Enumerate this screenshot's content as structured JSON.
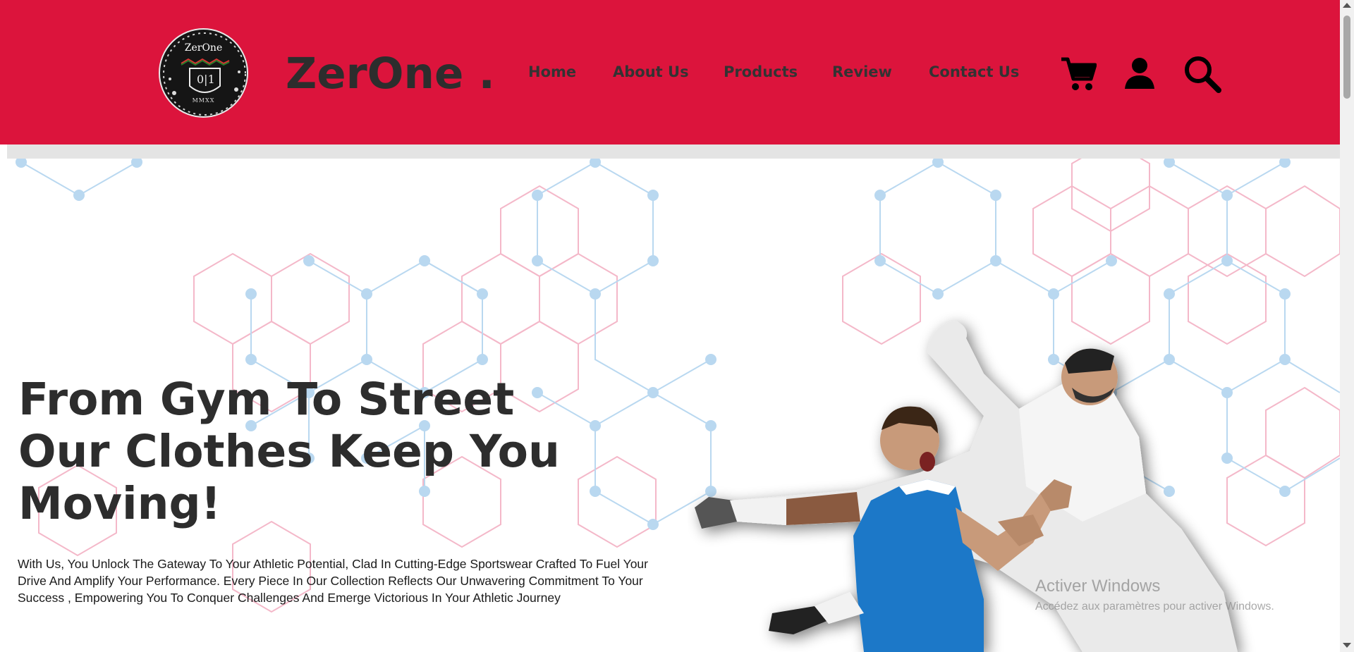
{
  "header": {
    "background_color": "#dc143c",
    "logo": {
      "name": "ZerOne",
      "subtitle": "MMXX"
    },
    "brand": "ZerOne .",
    "nav": [
      {
        "label": "Home"
      },
      {
        "label": "About Us"
      },
      {
        "label": "Products"
      },
      {
        "label": "Review"
      },
      {
        "label": "Contact Us"
      }
    ],
    "icons": [
      "cart-icon",
      "user-icon",
      "search-icon"
    ]
  },
  "hero": {
    "title_lines": [
      "From Gym To Street",
      "Our Clothes Keep You",
      "Moving!"
    ],
    "description": "With Us, You Unlock The Gateway To Your Athletic Potential, Clad In Cutting-Edge Sportswear Crafted To Fuel Your Drive And Amplify Your Performance. Every Piece In Our Collection Reflects Our Unwavering Commitment To Your Success , Empowering You To Conquer Challenges And Emerge Victorious In Your Athletic Journey"
  },
  "watermark": {
    "line1": "Activer Windows",
    "line2": "Accédez aux paramètres pour activer Windows."
  },
  "colors": {
    "accent": "#dc143c",
    "text_dark": "#2d2d2d",
    "hex_pink": "#f4b8c9",
    "hex_blue": "#b9d8f0"
  }
}
